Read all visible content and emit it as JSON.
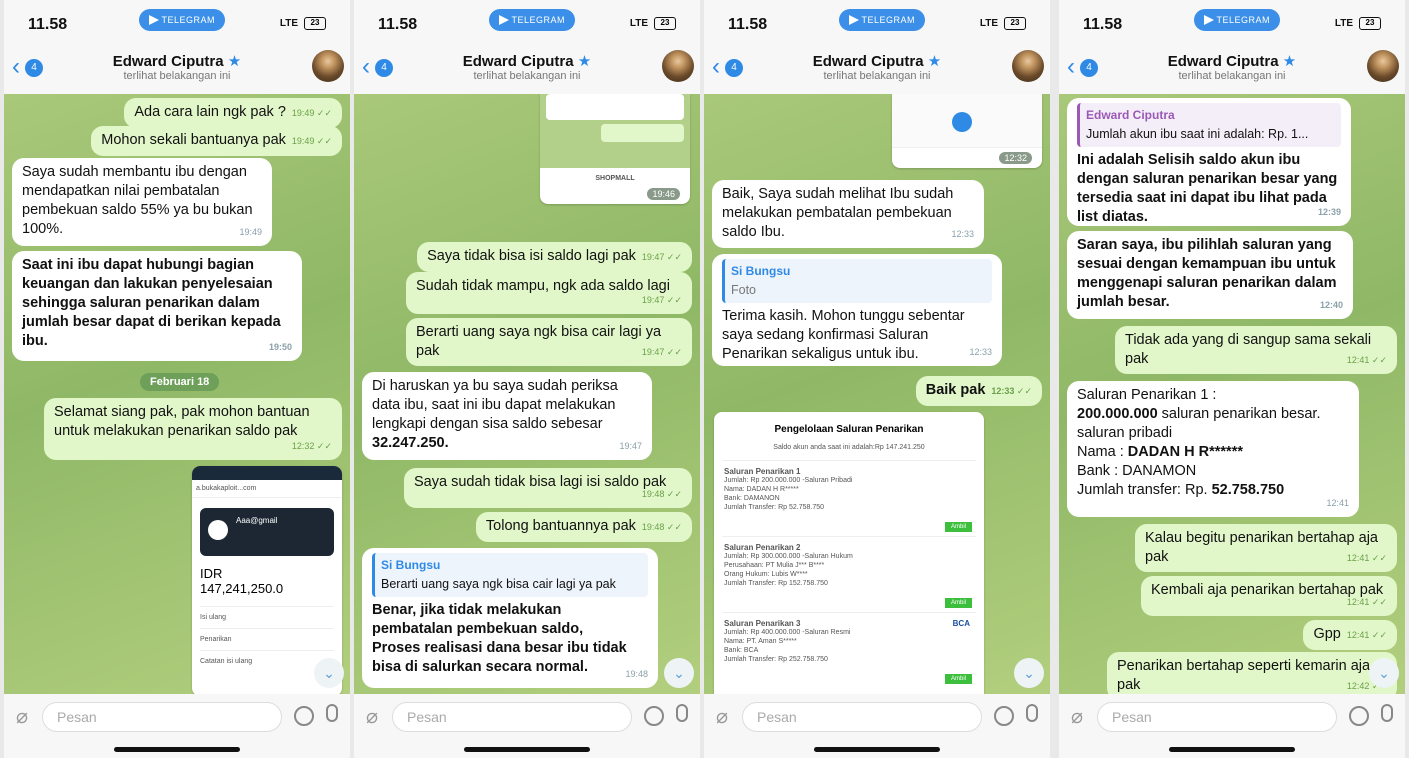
{
  "status": {
    "time": "11.58",
    "telegram": "TELEGRAM",
    "signal": "LTE",
    "battery": "23"
  },
  "header": {
    "back_count": "4",
    "name": "Edward Ciputra",
    "verified": "★",
    "subtitle": "terlihat belakangan ini"
  },
  "input": {
    "placeholder": "Pesan"
  },
  "p1": {
    "m1": {
      "text": "Ada cara lain ngk pak ?",
      "time": "19:49 ✓✓"
    },
    "m2": {
      "text": "Mohon sekali bantuanya pak",
      "time": "19:49 ✓✓"
    },
    "m3": {
      "lines": [
        "Saya sudah membantu ibu dengan",
        "mendapatkan nilai pembatalan",
        "pembekuan saldo 55% ya bu bukan",
        "100%."
      ],
      "time": "19:49"
    },
    "m4": {
      "lines": [
        "Saat ini ibu dapat hubungi bagian",
        "keuangan dan lakukan penyelesaian",
        "sehingga saluran penarikan dalam",
        "jumlah besar dapat di berikan kepada",
        "ibu."
      ],
      "time": "19:50"
    },
    "date": "Februari 18",
    "m5": {
      "lines": [
        "Selamat siang pak, pak mohon bantuan",
        "untuk melakukan penarikan saldo pak"
      ],
      "time": "12:32 ✓✓"
    },
    "shot": {
      "url": "a.bukakaploit...com",
      "account": "Aaa@gmail",
      "currency": "IDR",
      "balance": "147,241,250.0",
      "menu": [
        "Isi ulang",
        "Penarikan",
        "Catatan isi ulang"
      ]
    }
  },
  "p2": {
    "m1": {
      "text": "Saya tidak bisa isi saldo lagi pak",
      "time": "19:47 ✓✓"
    },
    "m2": {
      "text": "Sudah tidak mampu, ngk ada saldo lagi",
      "time": "19:47 ✓✓"
    },
    "m3": {
      "lines": [
        "Berarti uang saya ngk bisa cair lagi ya",
        "pak"
      ],
      "time": "19:47 ✓✓"
    },
    "m4": {
      "lines": [
        "Di haruskan ya bu saya sudah periksa",
        "data ibu, saat ini ibu dapat melakukan",
        "lengkapi dengan sisa saldo sebesar",
        "32.247.250."
      ],
      "time": "19:47"
    },
    "m5": {
      "text": "Saya sudah tidak bisa lagi isi saldo pak",
      "time": "19:48 ✓✓"
    },
    "m6": {
      "text": "Tolong bantuannya pak",
      "time": "19:48 ✓✓"
    },
    "m7": {
      "quote_name": "Si Bungsu",
      "quote_text": "Berarti uang saya ngk bisa cair lagi ya pak",
      "lines": [
        "Benar, jika tidak melakukan",
        "pembatalan pembekuan saldo,",
        "Proses realisasi dana besar ibu tidak",
        "bisa di salurkan secara normal."
      ],
      "time": "19:48"
    },
    "shot_time": "19:46",
    "shot_btn": "SHOPMALL"
  },
  "p3": {
    "shot_time": "12:32",
    "m1": {
      "lines": [
        "Baik, Saya sudah melihat Ibu sudah",
        "melakukan pembatalan pembekuan",
        "saldo Ibu."
      ],
      "time": "12:33"
    },
    "m2": {
      "quote_name": "Si Bungsu",
      "quote_text": "Foto",
      "lines": [
        "Terima kasih. Mohon tunggu sebentar",
        "saya sedang konfirmasi Saluran",
        "Penarikan sekaligus untuk ibu."
      ],
      "time": "12:33"
    },
    "m3": {
      "text": "Baik pak",
      "time": "12:33 ✓✓"
    },
    "doc": {
      "title": "Pengelolaan Saluran Penarikan",
      "sub": "Saldo akun anda saat ini adalah:Rp 147.241.250",
      "items": [
        {
          "head": "Saluran    Penarikan    1",
          "bank": "",
          "l1": "Jumlah: Rp 200.000.000    -Saluran Pribadi",
          "l2": "Nama: DADAN H R*****",
          "l3": "Bank: DAMANON",
          "l4": "Jumlah Transfer: Rp 52.758.750"
        },
        {
          "head": "Saluran    Penarikan    2",
          "bank": "",
          "l1": "Jumlah: Rp 300.000.000    -Saluran Hukum",
          "l2": "Perusahaan: PT Mulia J*** B****",
          "l3": "Orang Hukum: Lubis W****",
          "l4": "Jumlah Transfer: Rp 152.758.750"
        },
        {
          "head": "Saluran    Penarikan    3",
          "bank": "BCA",
          "l1": "Jumlah: Rp 400.000.000    -Saluran Resmi",
          "l2": "Nama: PT. Aman S*****",
          "l3": "Bank: BCA",
          "l4": "Jumlah Transfer: Rp 252.758.750"
        }
      ],
      "btn": "Ambil"
    }
  },
  "p4": {
    "m1": {
      "quote_name": "Edward Ciputra",
      "quote_text": "Jumlah akun ibu saat ini adalah: Rp. 1...",
      "lines": [
        "Ini adalah Selisih saldo akun ibu",
        "dengan saluran penarikan besar yang",
        "tersedia saat ini dapat ibu lihat pada",
        "list diatas."
      ],
      "time": "12:39"
    },
    "m2": {
      "lines": [
        "Saran saya, ibu pilihlah saluran yang",
        "sesuai dengan kemampuan ibu untuk",
        "menggenapi saluran penarikan dalam",
        "jumlah besar."
      ],
      "time": "12:40"
    },
    "m3": {
      "lines": [
        "Tidak ada yang di sangup sama sekali",
        "pak"
      ],
      "time": "12:41 ✓✓"
    },
    "m4": {
      "l1": "Saluran Penarikan 1 :",
      "l2": "200.000.000",
      "l2b": " saluran penarikan besar.",
      "l3": "saluran pribadi",
      "l4a": "Nama : ",
      "l4b": "DADAN H R******",
      "l5": "Bank : DANAMON",
      "l6a": "Jumlah transfer:  Rp. ",
      "l6b": "52.758.750",
      "time": "12:41"
    },
    "m5": {
      "lines": [
        "Kalau begitu penarikan bertahap aja",
        "pak"
      ],
      "time": "12:41 ✓✓"
    },
    "m6": {
      "text": "Kembali aja penarikan bertahap pak",
      "time": "12:41 ✓✓"
    },
    "m7": {
      "text": "Gpp",
      "time": "12:41 ✓✓"
    },
    "m8": {
      "lines": [
        "Penarikan bertahap seperti kemarin aja",
        "pak"
      ],
      "time": "12:42 ✓✓"
    }
  }
}
